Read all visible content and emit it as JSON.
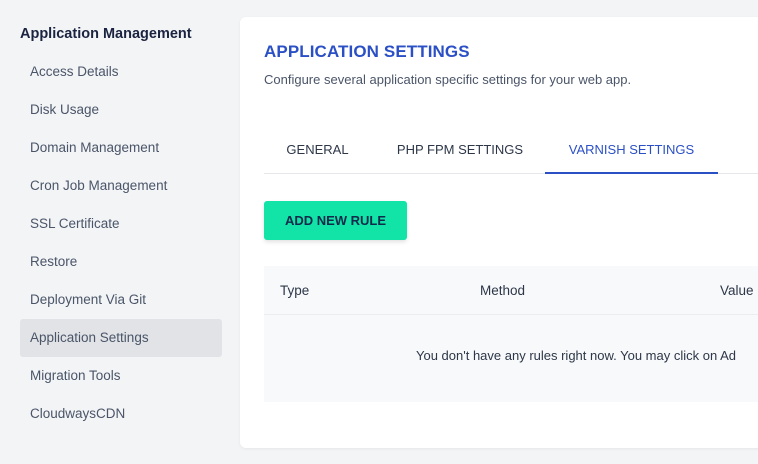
{
  "sidebar": {
    "title": "Application Management",
    "items": [
      {
        "label": "Access Details"
      },
      {
        "label": "Disk Usage"
      },
      {
        "label": "Domain Management"
      },
      {
        "label": "Cron Job Management"
      },
      {
        "label": "SSL Certificate"
      },
      {
        "label": "Restore"
      },
      {
        "label": "Deployment Via Git"
      },
      {
        "label": "Application Settings",
        "active": true
      },
      {
        "label": "Migration Tools"
      },
      {
        "label": "CloudwaysCDN"
      }
    ]
  },
  "main": {
    "title": "APPLICATION SETTINGS",
    "subtitle": "Configure several application specific settings for your web app.",
    "tabs": [
      {
        "label": "GENERAL"
      },
      {
        "label": "PHP FPM SETTINGS"
      },
      {
        "label": "VARNISH SETTINGS",
        "active": true
      }
    ],
    "add_rule_label": "ADD NEW RULE",
    "table": {
      "columns": [
        "Type",
        "Method",
        "Value"
      ],
      "empty_message": "You don't have any rules right now. You may click on Ad"
    }
  },
  "colors": {
    "accent": "#2b50c6",
    "button": "#12e3a7",
    "active_item_bg": "#e1e3e7"
  }
}
